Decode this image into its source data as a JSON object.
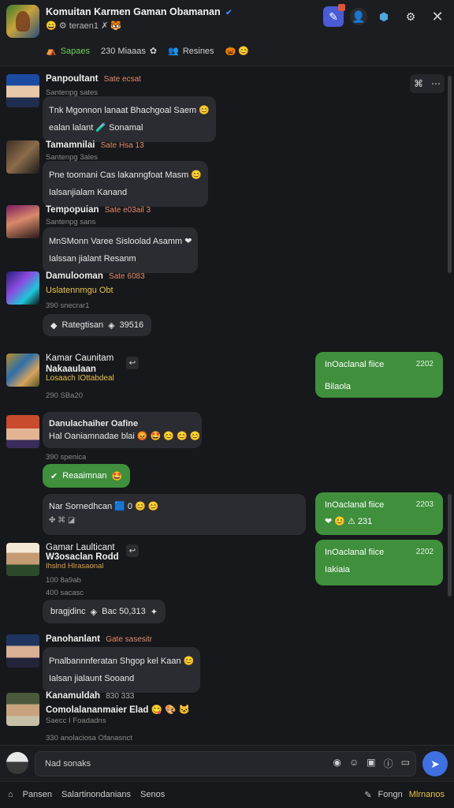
{
  "header": {
    "title": "Komuitan Karmen Gaman Obamanan",
    "subtitle": "teraen1",
    "subtitle_emojis_left": "😄 ⚙",
    "subtitle_emojis_right": "✗ 🐯",
    "tabs": [
      {
        "label": "Sapaes",
        "icon": "⛺"
      },
      {
        "label": "230 Miaaas",
        "icon": "✿"
      },
      {
        "label": "Resines",
        "icon": "👥"
      }
    ],
    "tab_tail_emojis": "🎃 😊"
  },
  "messages": [
    {
      "name": "Panpoultant",
      "meta": "Sate ecsat",
      "sub": "Santenpg sates",
      "lines": [
        "Tnk Mgonnon lanaat Bhachgoal Saem 😊",
        "ealan lalant 🧪 Sonamal"
      ]
    },
    {
      "name": "Tamamnilai",
      "meta": "Sate Hsa 13",
      "sub": "Santenpg 3ales",
      "lines": [
        "Pne toomani Cas lakanngfoat Masm 😊",
        "Ialsanjialam Kanand"
      ]
    },
    {
      "name": "Tempopuian",
      "meta": "Sate e03ail 3",
      "sub": "Santenpg sans",
      "lines": [
        "MnSMonn Varee Sisloolad Asamm ❤",
        "Ialssan jialant Resanm"
      ]
    },
    {
      "name": "Damulooman",
      "meta": "Sate 6083",
      "link": "Uslatennmgu Obt",
      "sub": "390 snecrar1",
      "pill": "Rategtisan",
      "pill_value": "39516"
    },
    {
      "name": "Kamar Caunitam",
      "name2": "Nakaaulaan",
      "link": "Losaach IOttabdeal",
      "sub": "290 SBa20",
      "green": {
        "title": "InOaclanal fiice",
        "time": "2202",
        "body": "Bilaola"
      }
    },
    {
      "name": "Danulachaiher Oafine",
      "line": "Hal Oaniamnadae blai 😡 🤩 😊 😊 😊",
      "sub": "390 spenica",
      "pill": "Reaaimnan"
    },
    {
      "line": "Nar Sornedhcan 🟦 0 😊 😊",
      "reacts": "✤ ⌘ ◪",
      "green": {
        "title": "InOaclanal fiice",
        "time": "2203",
        "body": "❤ 😊 ⚠ 231"
      }
    },
    {
      "name": "Gamar Laulticant",
      "link": "W3osaclan Rodd",
      "sub2": "Ihslnd Hlrasaonal",
      "sub": "100 8a9ab",
      "sub_b": "400 sacasc",
      "pill": "bragjdinc",
      "pill_value": "Bac 50,313",
      "green": {
        "title": "InOaclanal fiice",
        "time": "2202",
        "body": "Iakiaia"
      }
    },
    {
      "name": "Panohanlant",
      "meta": "Gate sasesitr",
      "lines": [
        "Pnalbannnferatan Shgop kel Kaan 😊",
        "Ialsan jialaunt Sooand"
      ]
    },
    {
      "name": "Kanamuldah",
      "meta": "830 333",
      "link": "Comolalananmaier Elad 😋 🎨 🐱",
      "sub": "Saecc I Foadadns",
      "sub_b": "330 anolaciosa Ofanasnct"
    }
  ],
  "composer": {
    "placeholder": "Nad sonaks"
  },
  "footer": {
    "left": [
      "Pansen",
      "Salartinondanians",
      "Senos"
    ],
    "right_label": "Fongn",
    "right_accent": "Mlrnanos"
  },
  "colors": {
    "accent_green": "#3f8f3c",
    "send_blue": "#3f6fe0",
    "background": "#17181b"
  }
}
